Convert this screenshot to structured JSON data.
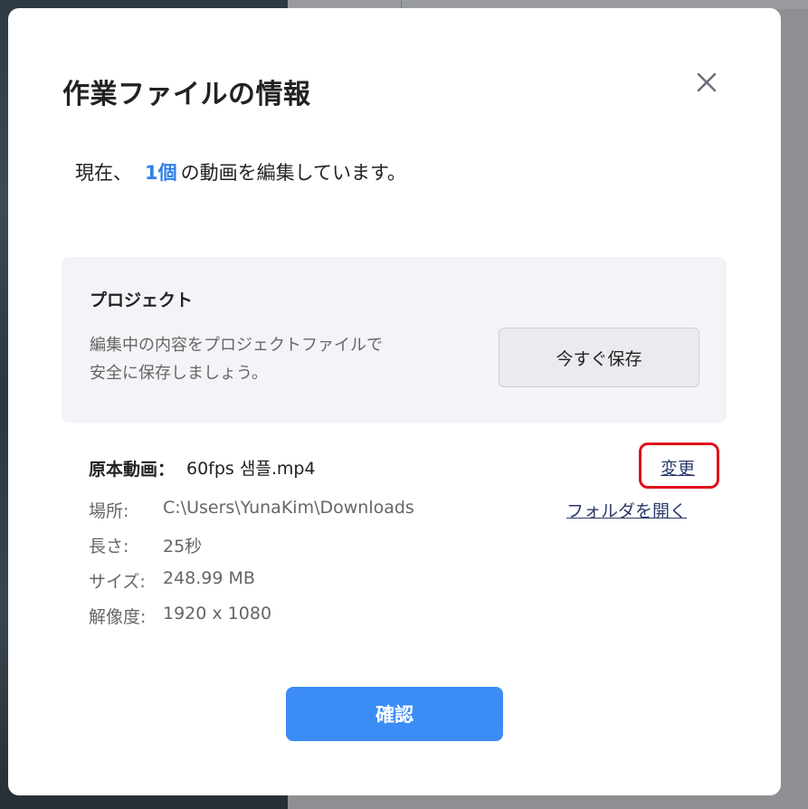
{
  "dialog": {
    "title": "作業ファイルの情報",
    "summary_prefix": "現在、",
    "summary_count": "1個",
    "summary_suffix": "の動画を編集しています。"
  },
  "project": {
    "title": "プロジェクト",
    "desc_line1": "編集中の内容をプロジェクトファイルで",
    "desc_line2": "安全に保存しましょう。",
    "save_label": "今すぐ保存"
  },
  "source": {
    "label": "原本動画：",
    "file_name": "60fps 샘플.mp4",
    "change_label": "変更",
    "open_folder_label": "フォルダを開く",
    "details": [
      {
        "label": "場所:",
        "value": "C:\\Users\\YunaKim\\Downloads"
      },
      {
        "label": "長さ:",
        "value": "25秒"
      },
      {
        "label": "サイズ:",
        "value": "248.99 MB"
      },
      {
        "label": "解像度:",
        "value": "1920 x 1080"
      }
    ]
  },
  "footer": {
    "confirm_label": "確認"
  },
  "icons": {
    "close": "close-icon"
  },
  "colors": {
    "accent": "#3c8cf5",
    "count_highlight": "#2f7fe8",
    "highlight_box": "#e0101a",
    "link": "#2c3a6b"
  }
}
